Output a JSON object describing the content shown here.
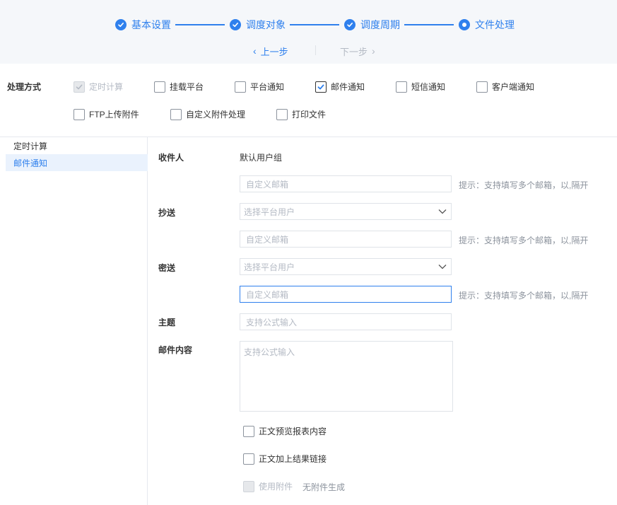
{
  "steps": [
    {
      "label": "基本设置",
      "state": "done"
    },
    {
      "label": "调度对象",
      "state": "done"
    },
    {
      "label": "调度周期",
      "state": "done"
    },
    {
      "label": "文件处理",
      "state": "current"
    }
  ],
  "nav": {
    "prev": "上一步",
    "next": "下一步"
  },
  "methods": {
    "title": "处理方式",
    "options": [
      {
        "label": "定时计算",
        "checked": true,
        "disabled": true
      },
      {
        "label": "挂载平台",
        "checked": false,
        "disabled": false
      },
      {
        "label": "平台通知",
        "checked": false,
        "disabled": false
      },
      {
        "label": "邮件通知",
        "checked": true,
        "disabled": false
      },
      {
        "label": "短信通知",
        "checked": false,
        "disabled": false
      },
      {
        "label": "客户端通知",
        "checked": false,
        "disabled": false
      },
      {
        "label": "FTP上传附件",
        "checked": false,
        "disabled": false
      },
      {
        "label": "自定义附件处理",
        "checked": false,
        "disabled": false
      },
      {
        "label": "打印文件",
        "checked": false,
        "disabled": false
      }
    ]
  },
  "sidebar": {
    "items": [
      {
        "label": "定时计算",
        "active": false
      },
      {
        "label": "邮件通知",
        "active": true
      }
    ]
  },
  "form": {
    "recipient": {
      "label": "收件人",
      "value": "默认用户组",
      "custom_placeholder": "自定义邮箱",
      "hint": "提示：支持填写多个邮箱，以,隔开"
    },
    "cc": {
      "label": "抄送",
      "select_placeholder": "选择平台用户",
      "custom_placeholder": "自定义邮箱",
      "hint": "提示：支持填写多个邮箱，以,隔开"
    },
    "bcc": {
      "label": "密送",
      "select_placeholder": "选择平台用户",
      "custom_placeholder": "自定义邮箱",
      "hint": "提示：支持填写多个邮箱，以,隔开"
    },
    "subject": {
      "label": "主题",
      "placeholder": "支持公式输入"
    },
    "content": {
      "label": "邮件内容",
      "placeholder": "支持公式输入"
    },
    "options": [
      {
        "label": "正文预览报表内容",
        "checked": false,
        "disabled": false
      },
      {
        "label": "正文加上结果链接",
        "checked": false,
        "disabled": false
      },
      {
        "label": "使用附件",
        "checked": false,
        "disabled": true
      }
    ],
    "attachment_note": "无附件生成"
  },
  "colors": {
    "accent": "#2f80ed",
    "muted": "#b4bac4",
    "header_bg": "#f5f7fa"
  }
}
